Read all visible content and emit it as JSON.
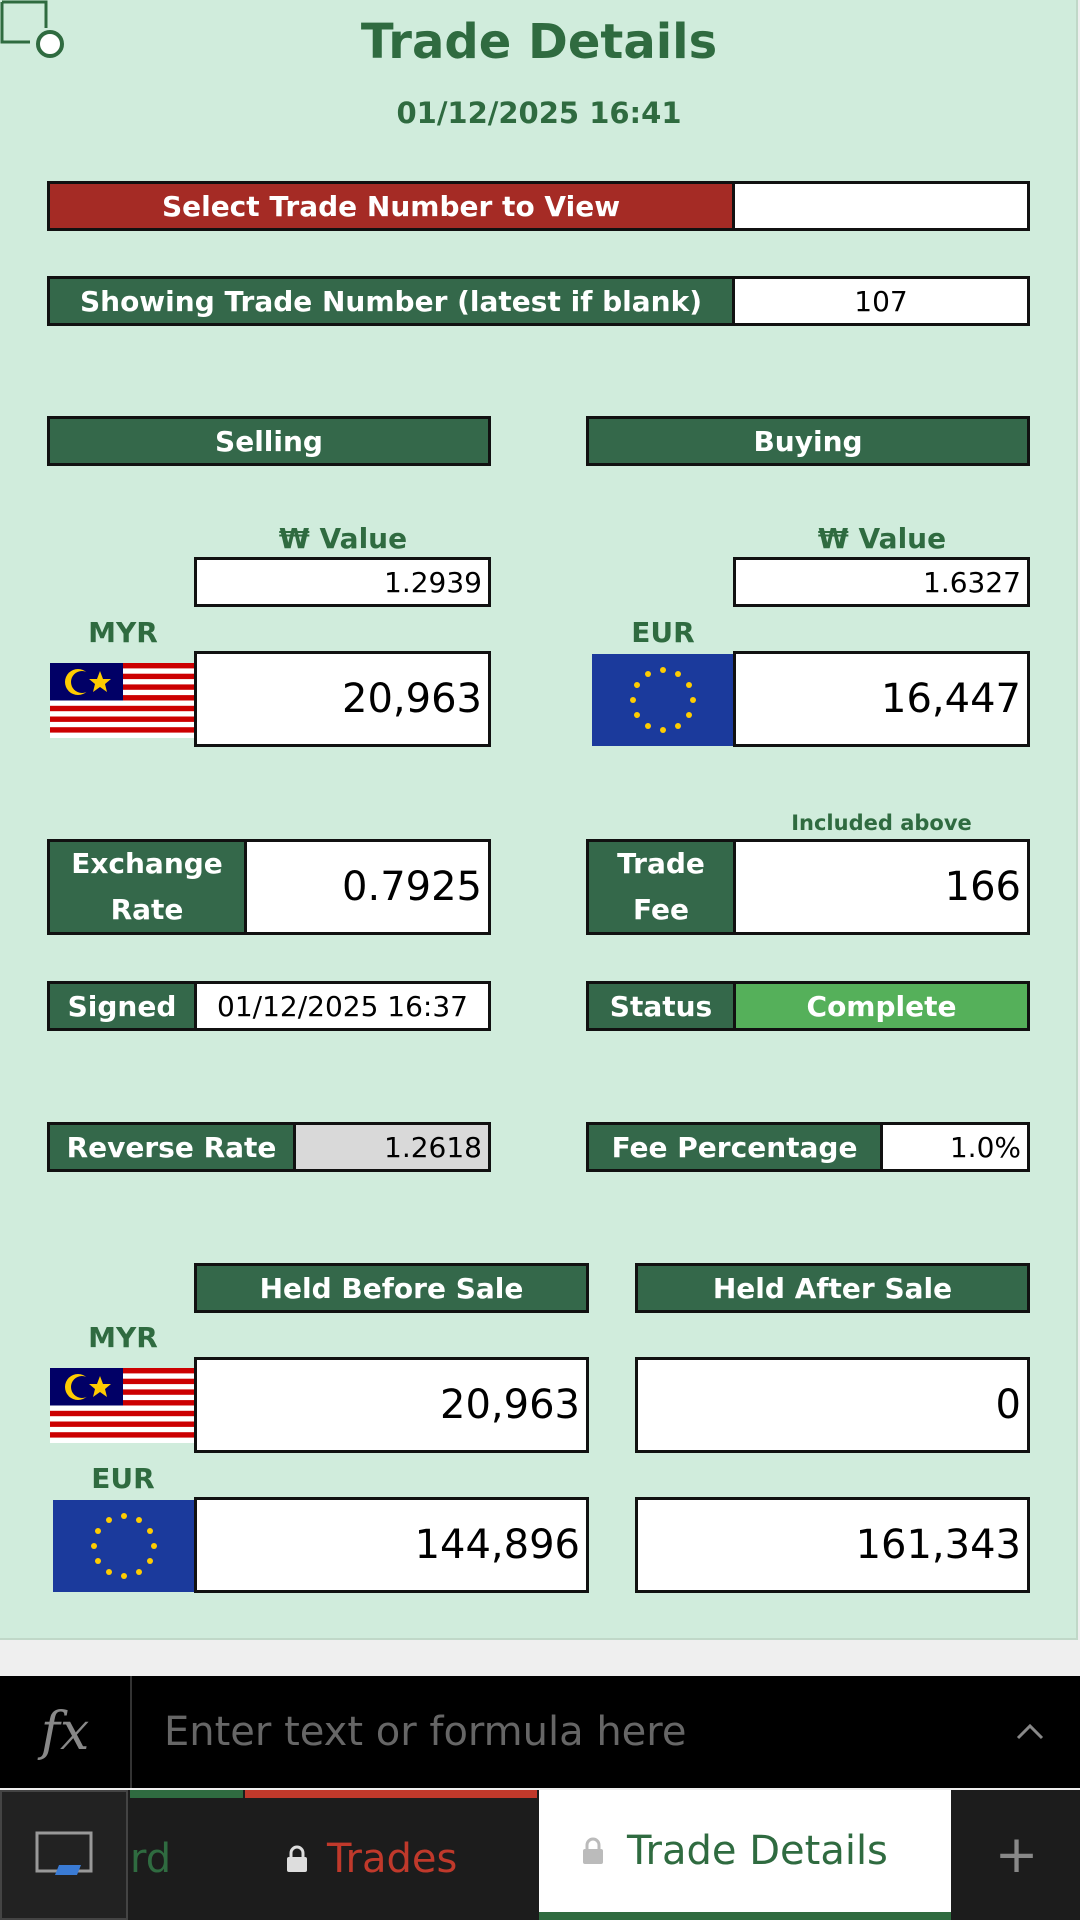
{
  "header": {
    "title": "Trade Details",
    "datetime": "01/12/2025 16:41"
  },
  "select_trade": {
    "label": "Select Trade Number to View",
    "value": ""
  },
  "showing_trade": {
    "label": "Showing Trade Number (latest if blank)",
    "value": "107"
  },
  "selling": {
    "header": "Selling",
    "value_label": "₩ Value",
    "won_value": "1.2939",
    "currency": "MYR",
    "amount": "20,963"
  },
  "buying": {
    "header": "Buying",
    "value_label": "₩ Value",
    "won_value": "1.6327",
    "currency": "EUR",
    "amount": "16,447"
  },
  "fee_note": "Included above",
  "exchange_rate": {
    "label_line1": "Exchange",
    "label_line2": "Rate",
    "value": "0.7925"
  },
  "trade_fee": {
    "label_line1": "Trade",
    "label_line2": "Fee",
    "value": "166"
  },
  "signed": {
    "label": "Signed",
    "value": "01/12/2025 16:37"
  },
  "status": {
    "label": "Status",
    "value": "Complete"
  },
  "reverse_rate": {
    "label": "Reverse Rate",
    "value": "1.2618"
  },
  "fee_percentage": {
    "label": "Fee Percentage",
    "value": "1.0%"
  },
  "holdings": {
    "before_header": "Held Before Sale",
    "after_header": "Held After Sale",
    "rows": [
      {
        "currency": "MYR",
        "before": "20,963",
        "after": "0"
      },
      {
        "currency": "EUR",
        "before": "144,896",
        "after": "161,343"
      }
    ]
  },
  "formula_bar": {
    "fx_label": "fx",
    "placeholder": "Enter text or formula here"
  },
  "tabs": {
    "partial_tab": "rd",
    "trades": "Trades",
    "trade_details": "Trade Details",
    "add": "+"
  },
  "colors": {
    "sheet_bg": "#d0ecdc",
    "header_green": "#34684a",
    "title_green": "#2f6b40",
    "select_red": "#a52b25",
    "status_green": "#55b05a",
    "trades_tab_red": "#c0392b"
  },
  "icons": [
    "sheet-select-corner-icon",
    "malaysia-flag-icon",
    "eu-flag-icon",
    "chevron-up-icon",
    "lock-icon",
    "sheet-view-icon",
    "plus-icon"
  ]
}
